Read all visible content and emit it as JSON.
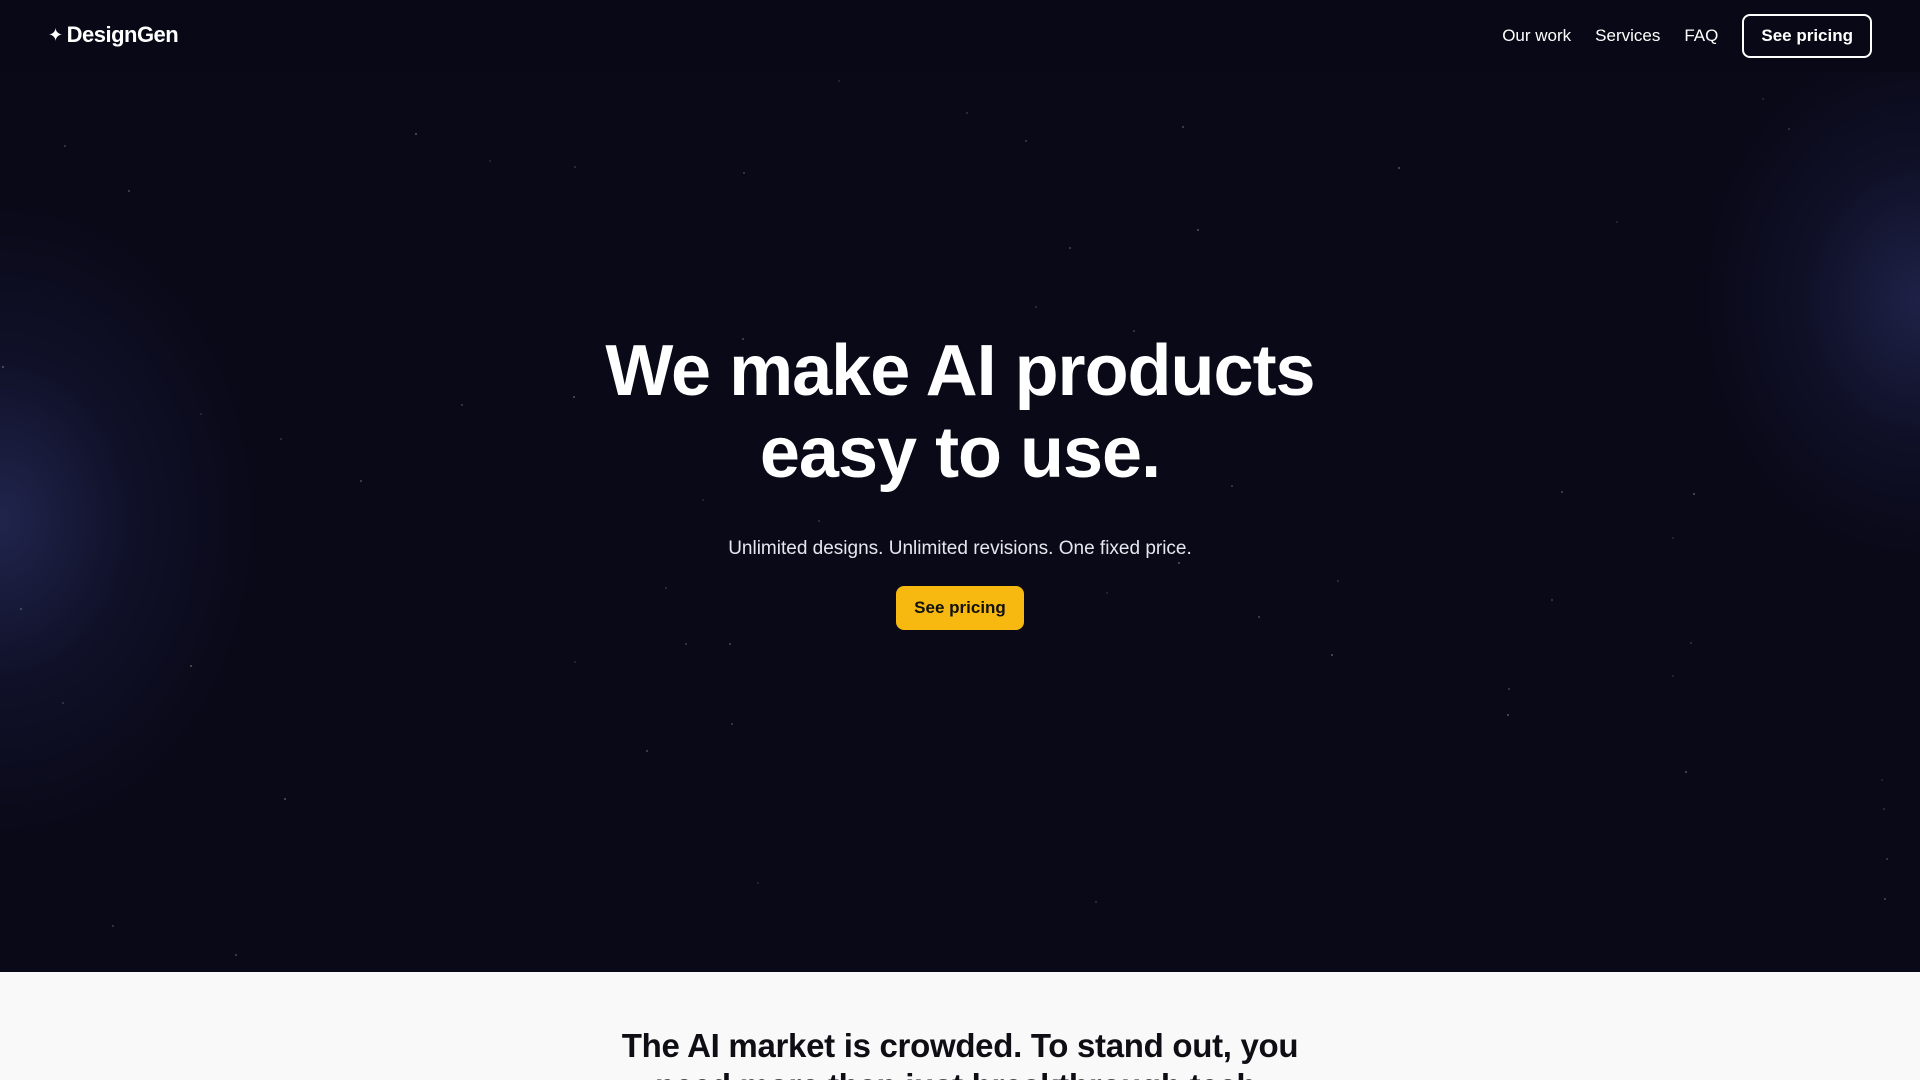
{
  "nav": {
    "logo_text": "DesignGen",
    "logo_icon": "sparkle-icon",
    "links": [
      {
        "label": "Our work"
      },
      {
        "label": "Services"
      },
      {
        "label": "FAQ"
      }
    ],
    "cta_label": "See pricing"
  },
  "hero": {
    "headline_line1": "We make AI products",
    "headline_line2": "easy to use.",
    "subtitle": "Unlimited designs. Unlimited revisions. One fixed price.",
    "cta_label": "See pricing"
  },
  "section_two": {
    "heading_line1": "The AI market is crowded. To stand out, you",
    "heading_line2": "need more than just breakthrough tech."
  },
  "colors": {
    "background": "#090918",
    "accent": "#f7b90f",
    "section_background": "#f9f9f9"
  }
}
